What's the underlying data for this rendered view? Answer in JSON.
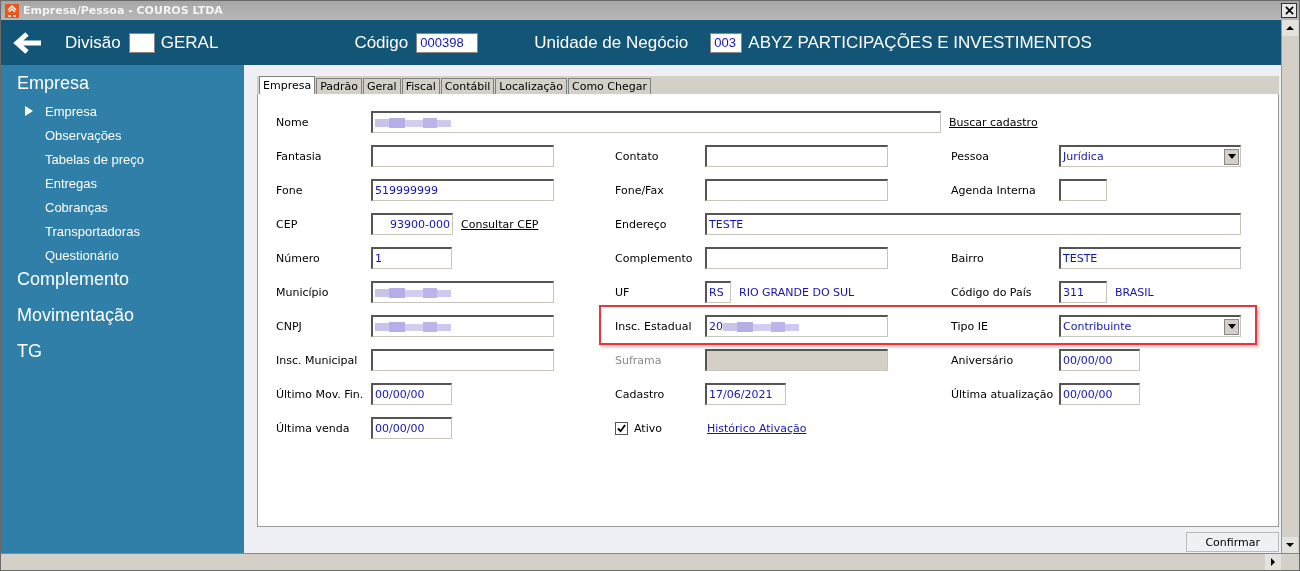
{
  "window": {
    "title": "Empresa/Pessoa - COUROS LTDA"
  },
  "header": {
    "divisao_label": "Divisão",
    "divisao_name": "GERAL",
    "codigo_label": "Código",
    "codigo_value": "000398",
    "unidade_label": "Unidade de Negócio",
    "unidade_value": "003",
    "unidade_name": "ABYZ PARTICIPAÇÕES E INVESTIMENTOS"
  },
  "sidebar": {
    "sections": [
      {
        "label": "Empresa",
        "children": [
          {
            "label": "Empresa",
            "selected": true
          },
          {
            "label": "Observações",
            "selected": false
          },
          {
            "label": "Tabelas de preço",
            "selected": false
          },
          {
            "label": "Entregas",
            "selected": false
          },
          {
            "label": "Cobranças",
            "selected": false
          },
          {
            "label": "Transportadoras",
            "selected": false
          },
          {
            "label": "Questionário",
            "selected": false
          }
        ]
      },
      {
        "label": "Complemento"
      },
      {
        "label": "Movimentação"
      },
      {
        "label": "TG"
      }
    ]
  },
  "tabs": [
    {
      "label": "Empresa",
      "selected": true
    },
    {
      "label": "Padrão",
      "selected": false
    },
    {
      "label": "Geral",
      "selected": false
    },
    {
      "label": "Fiscal",
      "selected": false
    },
    {
      "label": "Contábil",
      "selected": false
    },
    {
      "label": "Localização",
      "selected": false
    },
    {
      "label": "Como Chegar",
      "selected": false
    }
  ],
  "form": {
    "rows": [
      {
        "highlighted": false,
        "items": [
          {
            "label": "Nome",
            "kind": "text",
            "redacted": true,
            "after": {
              "kind": "link",
              "text": "Buscar cadastro"
            }
          }
        ]
      },
      {
        "highlighted": false,
        "items": [
          {
            "label": "Fantasia",
            "kind": "text"
          },
          {
            "label": "Contato",
            "kind": "text"
          },
          {
            "label": "Pessoa",
            "kind": "select",
            "value": "Jurídica"
          }
        ]
      },
      {
        "highlighted": false,
        "items": [
          {
            "label": "Fone",
            "kind": "text",
            "value": "519999999"
          },
          {
            "label": "Fone/Fax",
            "kind": "text"
          },
          {
            "label": "Agenda Interna",
            "kind": "text"
          }
        ]
      },
      {
        "highlighted": false,
        "items": [
          {
            "label": "CEP",
            "kind": "text",
            "value": "93900-000",
            "after": {
              "kind": "link",
              "text": "Consultar CEP"
            }
          },
          {
            "label": "Endereço",
            "kind": "text",
            "value": "TESTE"
          }
        ]
      },
      {
        "highlighted": false,
        "items": [
          {
            "label": "Número",
            "kind": "text",
            "value": "1"
          },
          {
            "label": "Complemento",
            "kind": "text"
          },
          {
            "label": "Bairro",
            "kind": "text",
            "value": "TESTE"
          }
        ]
      },
      {
        "highlighted": false,
        "items": [
          {
            "label": "Município",
            "kind": "text",
            "redacted": true
          },
          {
            "label": "UF",
            "kind": "text",
            "value": "RS",
            "after": {
              "kind": "text",
              "text": "RIO GRANDE DO SUL"
            }
          },
          {
            "label": "Código do País",
            "kind": "text",
            "value": "311",
            "after": {
              "kind": "text",
              "text": "BRASIL"
            }
          }
        ]
      },
      {
        "highlighted": true,
        "items": [
          {
            "label": "CNPJ",
            "kind": "text",
            "redacted": true
          },
          {
            "label": "Insc. Estadual",
            "kind": "text",
            "value": "20",
            "redacted": true
          },
          {
            "label": "Tipo IE",
            "kind": "select",
            "value": "Contribuinte"
          }
        ]
      },
      {
        "highlighted": false,
        "items": [
          {
            "label": "Insc. Municipal",
            "kind": "text"
          },
          {
            "label": "Suframa",
            "kind": "text",
            "disabled": true
          },
          {
            "label": "Aniversário",
            "kind": "text",
            "value": "00/00/00"
          }
        ]
      },
      {
        "highlighted": false,
        "items": [
          {
            "label": "Último Mov. Fin.",
            "kind": "text",
            "value": "00/00/00"
          },
          {
            "label": "Cadastro",
            "kind": "text",
            "value": "17/06/2021"
          },
          {
            "label": "Última atualização",
            "kind": "text",
            "value": "00/00/00"
          }
        ]
      },
      {
        "highlighted": false,
        "items": [
          {
            "label": "Última venda",
            "kind": "text",
            "value": "00/00/00"
          },
          {
            "label": "Ativo",
            "kind": "checkbox",
            "checked": true,
            "after": {
              "kind": "link",
              "text": "Histórico Ativação"
            }
          }
        ]
      }
    ]
  },
  "confirm_button": "Confirmar"
}
